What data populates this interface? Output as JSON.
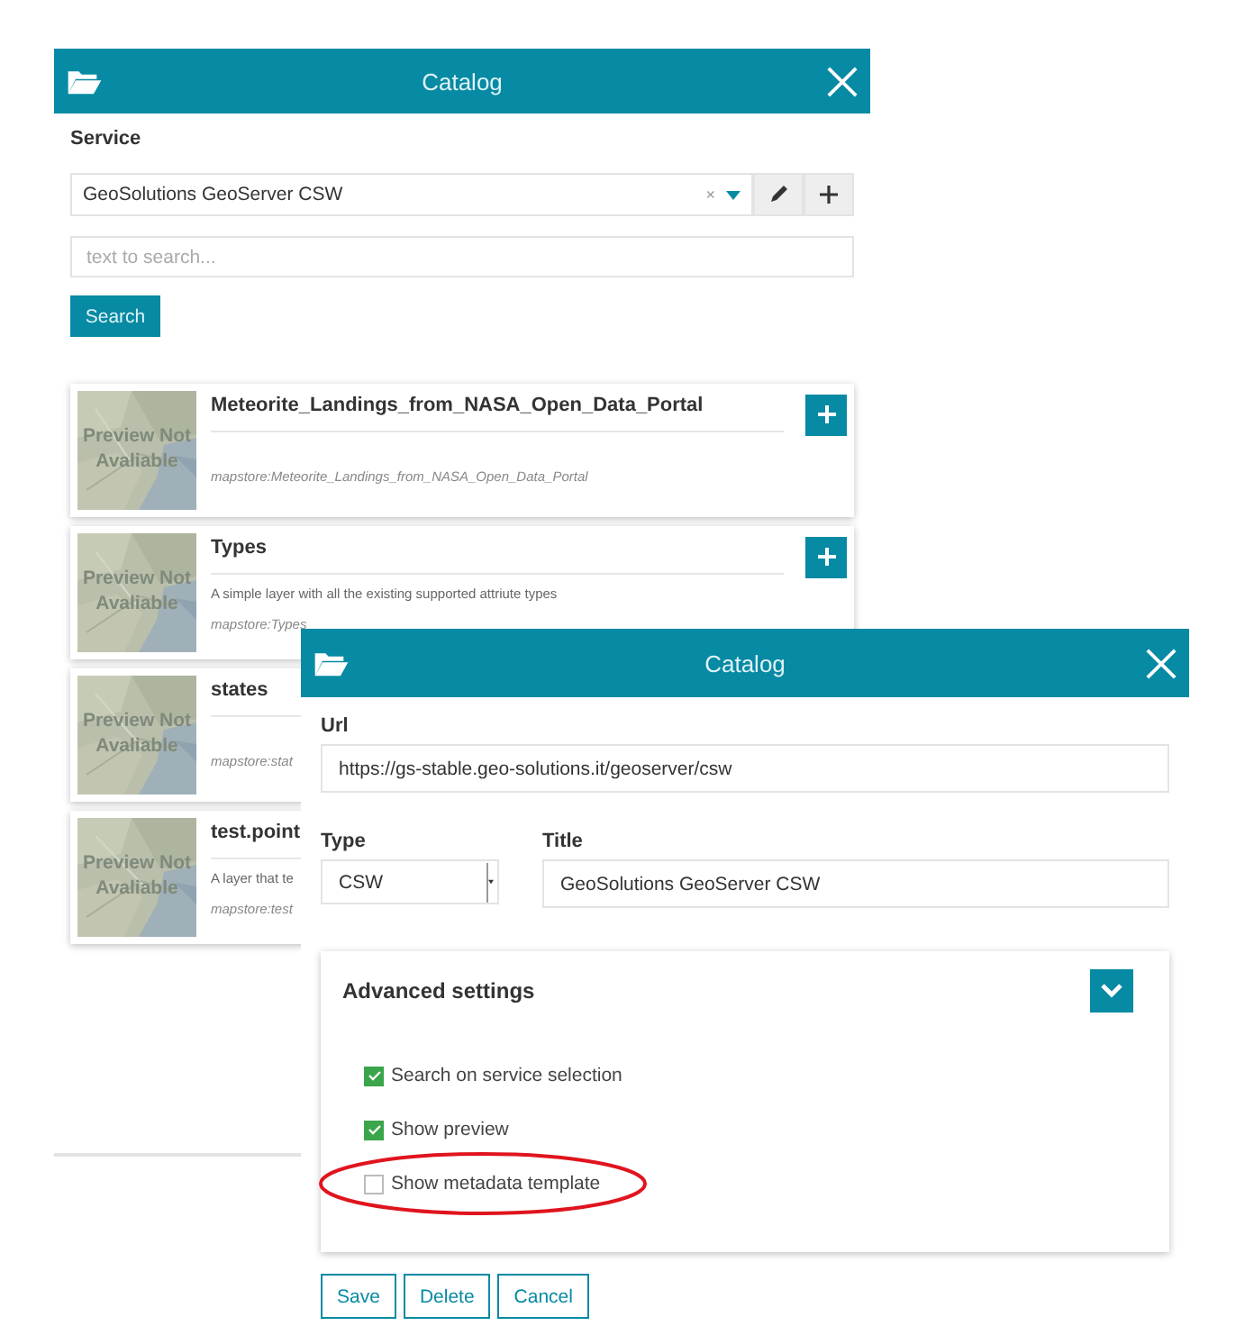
{
  "back_dialog": {
    "title": "Catalog",
    "service_label": "Service",
    "service_value": "GeoSolutions GeoServer CSW",
    "clear_symbol": "×",
    "search_placeholder": "text to search...",
    "search_button": "Search",
    "records": [
      {
        "title": "Meteorite_Landings_from_NASA_Open_Data_Portal",
        "identifier": "mapstore:Meteorite_Landings_from_NASA_Open_Data_Portal",
        "preview_text": "Preview Not Avaliable",
        "add_button": true
      },
      {
        "title": "Types",
        "description": "A simple layer with all the existing supported attriute types",
        "identifier": "mapstore:Types",
        "preview_text": "Preview Not Avaliable",
        "add_button": true
      },
      {
        "title": "states",
        "identifier": "mapstore:stat",
        "preview_text": "Preview Not Avaliable",
        "add_button": false
      },
      {
        "title": "test.point",
        "description": "A layer that te",
        "identifier": "mapstore:test",
        "preview_text": "Preview Not Avaliable",
        "add_button": false
      }
    ]
  },
  "front_dialog": {
    "title": "Catalog",
    "url_label": "Url",
    "url_value": "https://gs-stable.geo-solutions.it/geoserver/csw",
    "type_label": "Type",
    "type_value": "CSW",
    "title_label": "Title",
    "title_value": "GeoSolutions GeoServer CSW",
    "advanced": {
      "title": "Advanced settings",
      "expanded": true,
      "options": [
        {
          "label": "Search on service selection",
          "checked": true
        },
        {
          "label": "Show preview",
          "checked": true
        },
        {
          "label": "Show metadata template",
          "checked": false,
          "highlighted": true
        }
      ]
    },
    "buttons": [
      "Save",
      "Delete",
      "Cancel"
    ]
  }
}
